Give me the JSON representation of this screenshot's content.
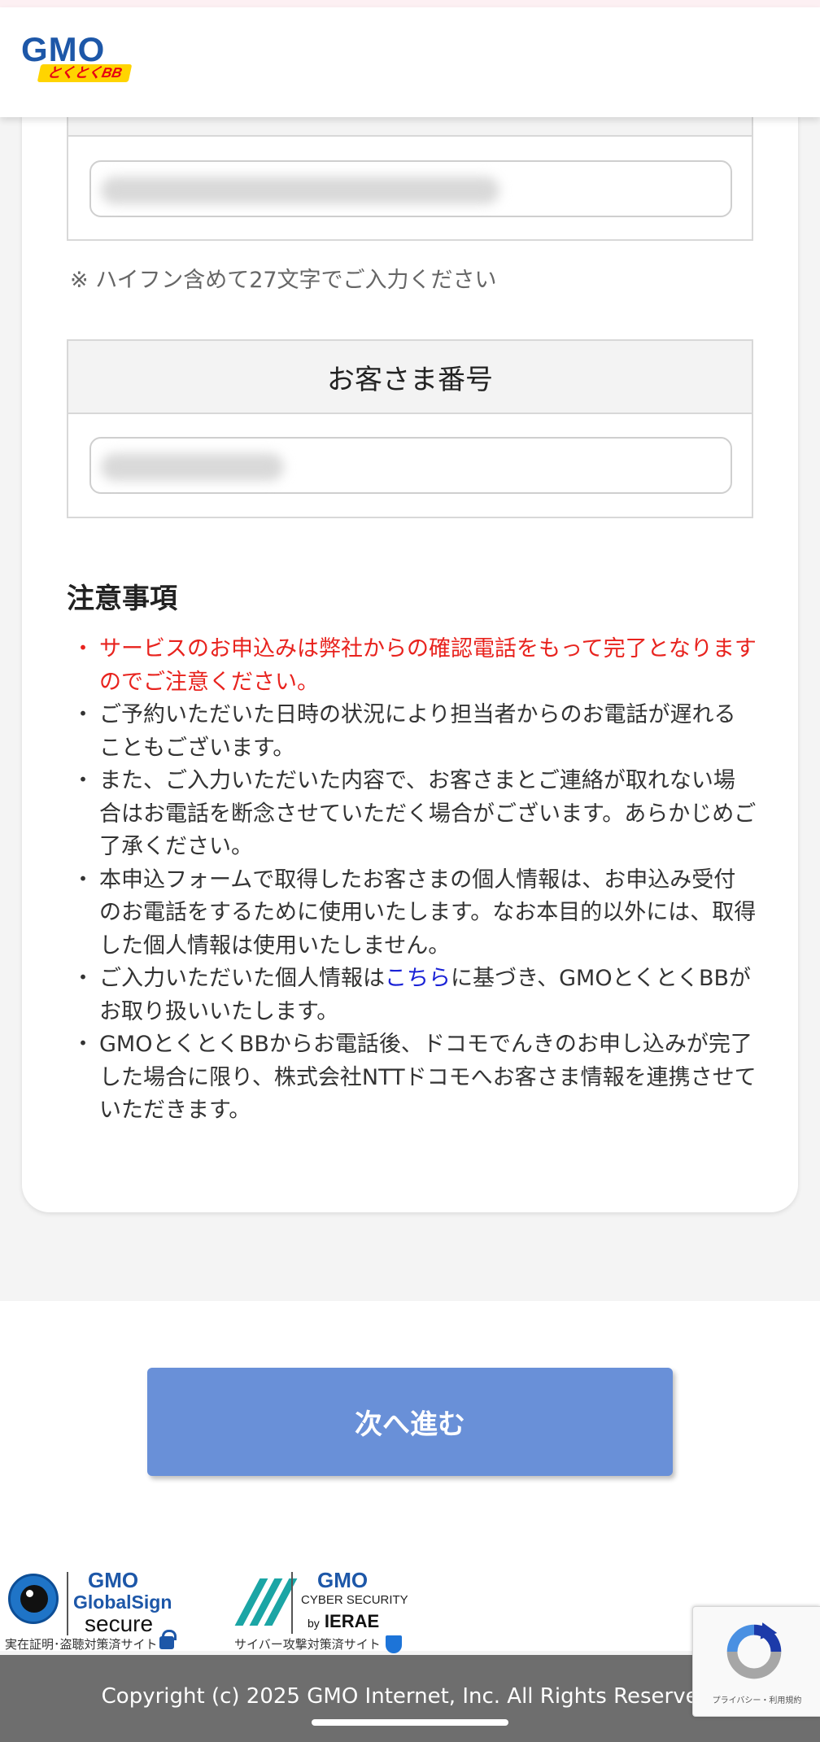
{
  "header": {
    "logo_main": "GMO",
    "logo_sub": "とくとくBB"
  },
  "form": {
    "field1": {
      "heading": "",
      "value_redacted": true
    },
    "field1_hint": "※ ハイフン含めて27文字でご入力ください",
    "field2": {
      "heading": "お客さま番号",
      "value_redacted": true
    }
  },
  "notes": {
    "title": "注意事項",
    "items": [
      {
        "text": "サービスのお申込みは弊社からの確認電話をもって完了となりますのでご注意ください。",
        "style": "warning"
      },
      {
        "text": "ご予約いただいた日時の状況により担当者からのお電話が遅れることもございます。",
        "style": "normal"
      },
      {
        "text": "また、ご入力いただいた内容で、お客さまとご連絡が取れない場合はお電話を断念させていただく場合がございます。あらかじめご了承ください。",
        "style": "normal"
      },
      {
        "text": "本申込フォームで取得したお客さまの個人情報は、お申込み受付のお電話をするために使用いたします。なお本目的以外には、取得した個人情報は使用いたしません。",
        "style": "normal"
      },
      {
        "text_before": "ご入力いただいた個人情報は",
        "link": "こちら",
        "text_after": "に基づき、GMOとくとくBBがお取り扱いいたします。",
        "style": "normal"
      },
      {
        "text": "GMOとくとくBBからお電話後、ドコモでんきのお申し込みが完了した場合に限り、株式会社NTTドコモへお客さま情報を連携させていただきます。",
        "style": "normal"
      }
    ]
  },
  "actions": {
    "next_label": "次へ進む"
  },
  "badges": {
    "globalsign": {
      "brand": "GMO",
      "name": "GlobalSign",
      "secure": "secure",
      "caption": "実在証明･盗聴対策済サイト",
      "icon": "lock-icon"
    },
    "cybersecurity": {
      "brand": "GMO",
      "name": "CYBER SECURITY",
      "by": "by",
      "vendor": "IERAE",
      "caption": "サイバー攻撃対策済サイト",
      "icon": "shield-check-icon"
    }
  },
  "recaptcha": {
    "legal": "プライバシー・利用規約"
  },
  "footer": {
    "copyright": "Copyright (c) 2025 GMO Internet, Inc. All Rights Reserved."
  },
  "colors": {
    "warning": "#e8231e",
    "link": "#1a22d6",
    "button": "#6990d8",
    "brand": "#1d57a8",
    "footer": "#6e6e6e"
  }
}
